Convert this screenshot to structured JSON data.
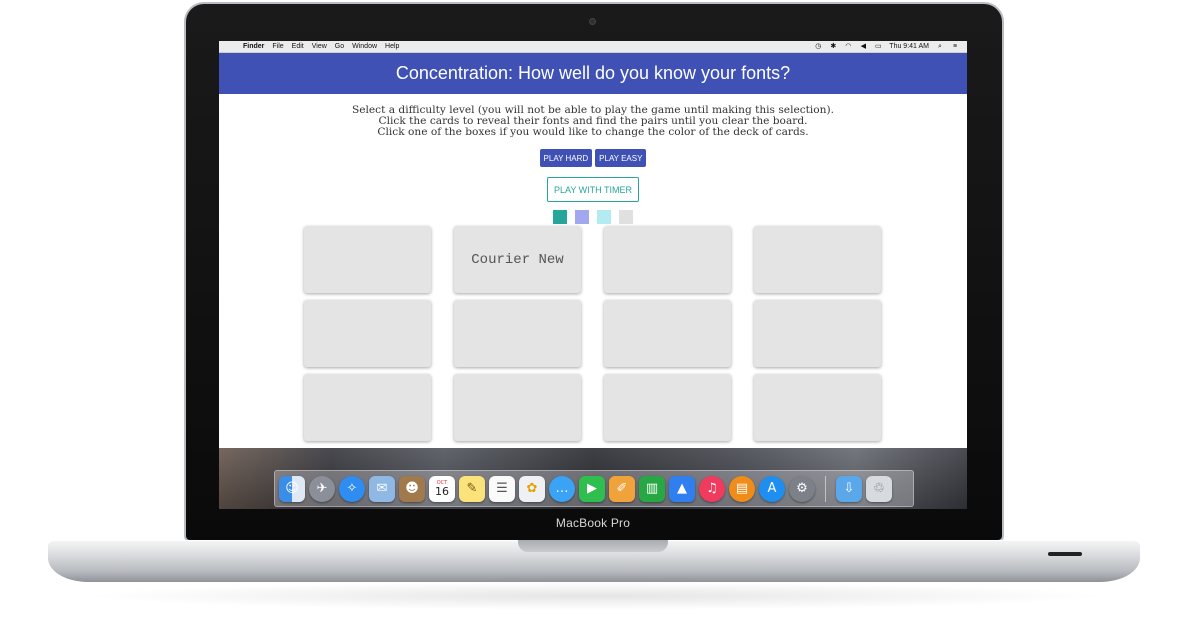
{
  "menubar": {
    "apple": "",
    "items": [
      "Finder",
      "File",
      "Edit",
      "View",
      "Go",
      "Window",
      "Help"
    ],
    "clock": "Thu 9:41 AM"
  },
  "header": {
    "title": "Concentration: How well do you know your fonts?"
  },
  "instructions": [
    "Select a difficulty level (you will not be able to play the game until making this selection).",
    "Click the cards to reveal their fonts and find the pairs until you clear the board.",
    "Click one of the boxes if you would like to change the color of the deck of cards."
  ],
  "buttons": {
    "play_hard": "PLAY HARD",
    "play_easy": "PLAY EASY",
    "play_timer": "PLAY WITH TIMER"
  },
  "swatches": [
    "#26a69a",
    "#a2a8f0",
    "#b2ebf2",
    "#e0e0e0"
  ],
  "cards": [
    "",
    "Courier New",
    "",
    "",
    "",
    "",
    "",
    "",
    "",
    "",
    "",
    ""
  ],
  "dock": {
    "calendar_month": "OCT",
    "calendar_day": "16",
    "icons": [
      "finder-icon",
      "launchpad-icon",
      "safari-icon",
      "mail-icon",
      "contacts-icon",
      "calendar-icon",
      "notes-icon",
      "reminders-icon",
      "photos-icon",
      "messages-icon",
      "facetime-icon",
      "pages-icon",
      "numbers-icon",
      "keynote-icon",
      "itunes-icon",
      "ibooks-icon",
      "app-store-icon",
      "system-preferences-icon",
      "downloads-icon",
      "trash-icon"
    ]
  },
  "device": {
    "label": "MacBook Pro"
  }
}
